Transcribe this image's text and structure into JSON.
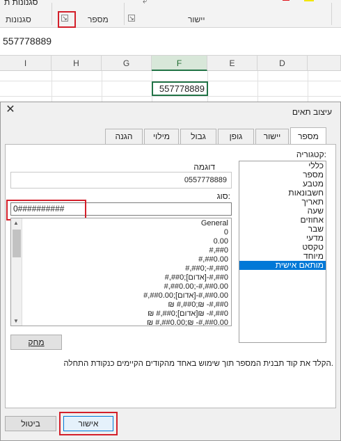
{
  "ribbon": {
    "styles_label": "סגנונות",
    "styles_button": "סגנונות ת",
    "number_label": "מספר",
    "alignment_label": "יישור"
  },
  "formula_bar": {
    "value": "557778889"
  },
  "columns": [
    "I",
    "H",
    "G",
    "F",
    "E",
    "D"
  ],
  "active_cell": {
    "value": "557778889"
  },
  "dialog": {
    "title": "עיצוב תאים",
    "close_symbol": "✕",
    "tabs": [
      "מספר",
      "יישור",
      "גופן",
      "גבול",
      "מילוי",
      "הגנה"
    ],
    "category_label": "קטגוריה:",
    "categories": [
      "כללי",
      "מספר",
      "מטבע",
      "חשבונאות",
      "תאריך",
      "שעה",
      "אחוזים",
      "שבר",
      "מדעי",
      "טקסט",
      "מיוחד",
      "מותאם אישית"
    ],
    "selected_category": "מותאם אישית",
    "sample_label": "דוגמה",
    "sample_value": "0557778889",
    "type_label": "סוג:",
    "type_value": "0##########",
    "formats": [
      "General",
      "0",
      "0.00",
      "#,##0",
      "#,##0.00",
      "#,##0;-#,##0",
      "#,##0;[אדום]-#,##0",
      "#,##0.00;-#,##0.00",
      "#,##0.00;[אדום]-#,##0.00",
      "₪ #,##0;₪ -#,##0",
      "₪ #,##0;[אדום]₪ -#,##0",
      "₪ #,##0.00;₪ -#,##0.00"
    ],
    "delete_button": "מחק",
    "hint": "הקלד את קוד תבנית המספר תוך שימוש באחד מהקודים הקיימים כנקודת התחלה.",
    "ok_button": "אישור",
    "cancel_button": "ביטול"
  },
  "colors": {
    "highlight_red": "#d31f2a",
    "excel_green": "#217346",
    "selection_blue": "#0078d7"
  }
}
